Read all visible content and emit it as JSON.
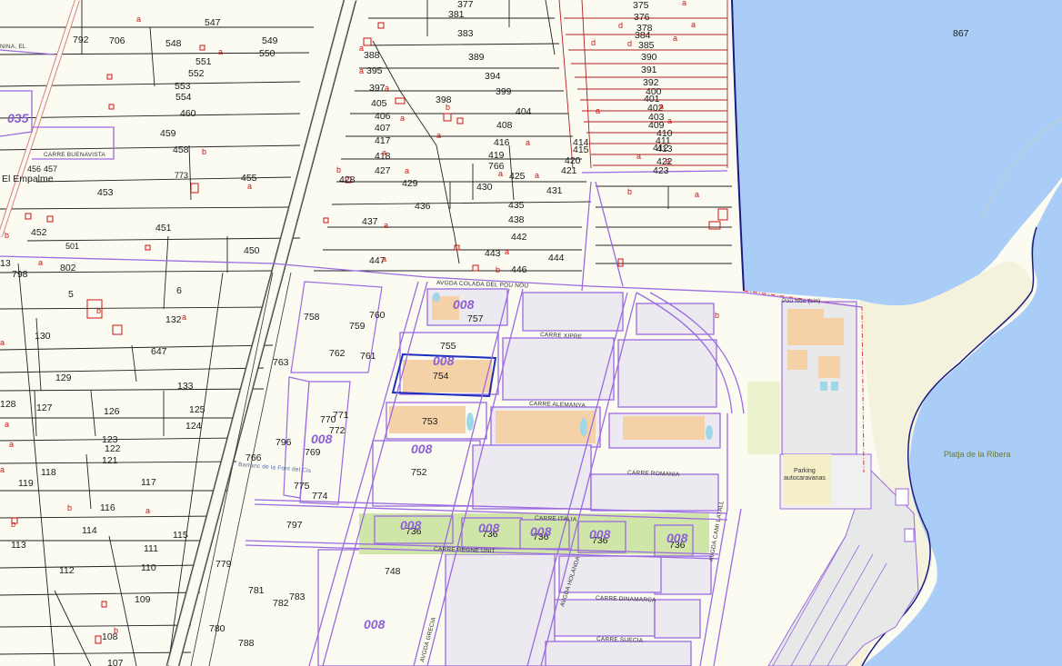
{
  "map": {
    "sea_parcel": "867",
    "beach_label": "Platja de la Ribera",
    "parking_label": [
      "Parking",
      "autocaravanas"
    ],
    "place_labels": [
      "El Empalme",
      "NINA, EL"
    ],
    "sector_label": "035",
    "zone_code": "008",
    "streets": [
      "AVGDA COLADA DEL POU NOU",
      "CARRE XIPRE",
      "CARRE ALEMANYA",
      "CARRE ROMANIA",
      "CARRE ITALIA",
      "CARRE REGNE UNIT",
      "CARRE DINAMARCA",
      "CARRE SUECIA",
      "AVGDA HOLANDA",
      "AVGDA GRECIA",
      "AVGDA CAMI LATALL",
      "CARRE BUENAVISTA",
      "Barranc de la Font del Cis",
      "Pou Nou (sin)"
    ],
    "colors": {
      "sea": "#a9cdf7",
      "land": "#fcfbf2",
      "parcel_line": "#222222",
      "zone_line": "#9b6ae0",
      "building": "#cc1111",
      "selected": "#1a2fbf",
      "park": "#cfe6a8"
    },
    "parcels_left": [
      "792",
      "706",
      "548",
      "549",
      "550",
      "551",
      "552",
      "553",
      "554",
      "460",
      "459",
      "458",
      "455",
      "453",
      "452",
      "451",
      "450",
      "13",
      "798",
      "802",
      "5",
      "6",
      "132",
      "130",
      "647",
      "129",
      "133",
      "128",
      "127",
      "126",
      "125",
      "124",
      "123",
      "122",
      "121",
      "118",
      "119",
      "117",
      "116",
      "114",
      "115",
      "113",
      "111",
      "110",
      "112",
      "109",
      "108",
      "107",
      "547",
      "456",
      "457",
      "773",
      "775",
      "772",
      "771",
      "770",
      "769",
      "774",
      "763",
      "766",
      "796",
      "797",
      "779",
      "781",
      "782",
      "783",
      "780",
      "788",
      "758",
      "759",
      "760",
      "762",
      "761",
      "501"
    ],
    "parcels_middle": [
      "383",
      "388",
      "389",
      "394",
      "395",
      "397",
      "399",
      "398",
      "404",
      "405",
      "406",
      "407",
      "408",
      "417",
      "416",
      "418",
      "419",
      "420",
      "421",
      "427",
      "428",
      "429",
      "430",
      "431",
      "435",
      "436",
      "437",
      "438",
      "442",
      "443",
      "444",
      "446",
      "447",
      "766",
      "425",
      "377",
      "381",
      "375"
    ],
    "parcels_east": [
      "376",
      "378",
      "384",
      "385",
      "390",
      "391",
      "392",
      "400",
      "401",
      "402",
      "403",
      "409",
      "410",
      "411",
      "412",
      "413",
      "414",
      "415",
      "422",
      "423"
    ],
    "parcels_zone": [
      "757",
      "755",
      "754",
      "753",
      "752",
      "748",
      "736"
    ]
  }
}
